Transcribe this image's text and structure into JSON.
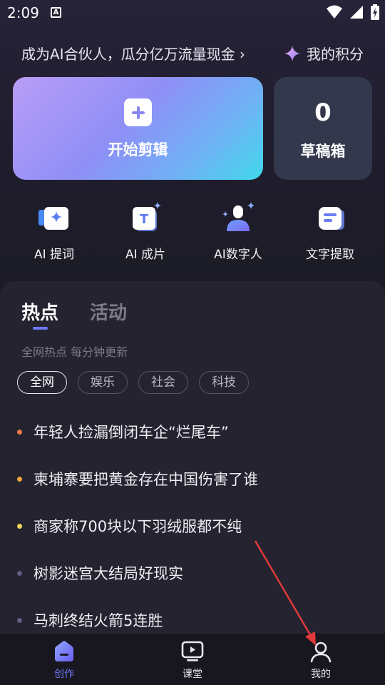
{
  "status": {
    "time": "2:09",
    "notif_glyph": "A"
  },
  "promo": {
    "text": "成为AI合伙人，瓜分亿万流量现金 ›",
    "points_label": "我的积分"
  },
  "start_card": {
    "label": "开始剪辑"
  },
  "draft_card": {
    "count": "0",
    "label": "草稿箱"
  },
  "tools": [
    {
      "label": "AI 提词",
      "icon": "ai-prompt-icon"
    },
    {
      "label": "AI 成片",
      "icon": "ai-film-icon"
    },
    {
      "label": "AI数字人",
      "icon": "ai-avatar-icon"
    },
    {
      "label": "文字提取",
      "icon": "text-extract-icon"
    }
  ],
  "panel": {
    "tabs": [
      "热点",
      "活动"
    ],
    "subtitle": "全网热点 每分钟更新",
    "chips": [
      "全网",
      "娱乐",
      "社会",
      "科技"
    ],
    "news": [
      {
        "text": "年轻人捡漏倒闭车企“烂尾车”",
        "dot_color": "#f07a4a"
      },
      {
        "text": "柬埔寨要把黄金存在中国伤害了谁",
        "dot_color": "#f2a93b"
      },
      {
        "text": "商家称700块以下羽绒服都不纯",
        "dot_color": "#f3d35a"
      },
      {
        "text": "树影迷宫大结局好现实",
        "dot_color": "#5f5c80"
      },
      {
        "text": "马刺终结火箭5连胜",
        "dot_color": "#5f5c80"
      }
    ]
  },
  "nav": [
    {
      "label": "创作",
      "color": "#6b78f6",
      "icon": "create-icon"
    },
    {
      "label": "课堂",
      "color": "#e8e8ee",
      "icon": "classroom-icon"
    },
    {
      "label": "我的",
      "color": "#e8e8ee",
      "icon": "profile-icon"
    }
  ],
  "colors": {
    "accent": "#6b78f6",
    "annotation_arrow": "#e03a3a"
  }
}
